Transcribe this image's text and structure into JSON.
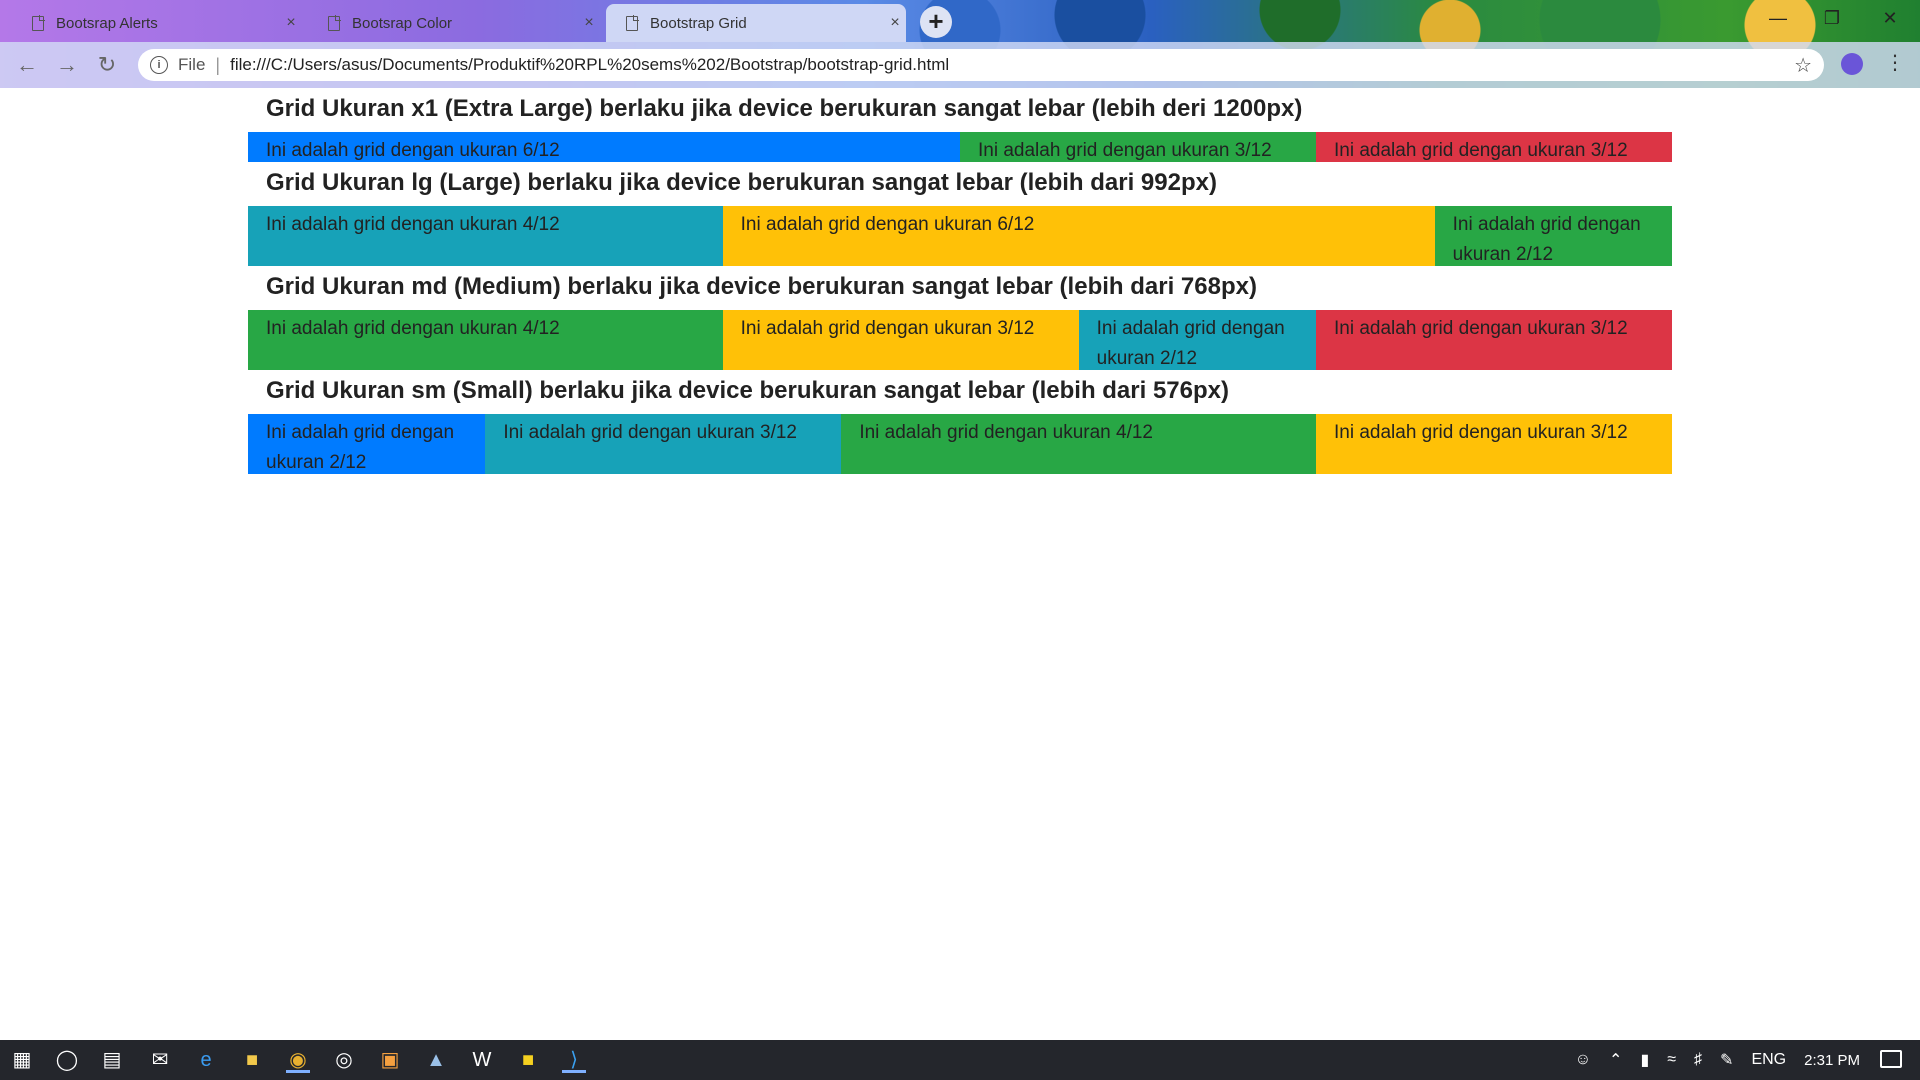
{
  "browser": {
    "tabs": [
      {
        "title": "Bootsrap Alerts",
        "close": "×"
      },
      {
        "title": "Bootsrap Color",
        "close": "×"
      },
      {
        "title": "Bootstrap Grid",
        "close": "×"
      }
    ],
    "new_tab": "+",
    "address": {
      "scheme_label": "File",
      "separator": "|",
      "url": "file:///C:/Users/asus/Documents/Produktif%20RPL%20sems%202/Bootstrap/bootstrap-grid.html"
    },
    "icons": {
      "back": "back-arrow-icon",
      "forward": "forward-arrow-icon",
      "reload": "reload-icon",
      "info": "info-icon",
      "bookmark": "star-icon",
      "profile": "profile-icon",
      "menu": "menu-icon"
    }
  },
  "page": {
    "sections": [
      {
        "title": "Grid Ukuran x1 (Extra Large) berlaku jika device berukuran sangat lebar (lebih deri 1200px)",
        "cols": [
          {
            "text": "Ini adalah grid dengan ukuran 6/12",
            "span": 6,
            "color": "#007bff"
          },
          {
            "text": "Ini adalah grid dengan ukuran 3/12",
            "span": 3,
            "color": "#28a745"
          },
          {
            "text": "Ini adalah grid dengan ukuran 3/12",
            "span": 3,
            "color": "#dc3545"
          }
        ]
      },
      {
        "title": "Grid Ukuran lg (Large) berlaku jika device berukuran sangat lebar (lebih dari 992px)",
        "cols": [
          {
            "text": "Ini adalah grid dengan ukuran 4/12",
            "span": 4,
            "color": "#17a2b8"
          },
          {
            "text": "Ini adalah grid dengan ukuran 6/12",
            "span": 6,
            "color": "#ffc107"
          },
          {
            "text": "Ini adalah grid dengan ukuran 2/12",
            "span": 2,
            "color": "#28a745"
          }
        ]
      },
      {
        "title": "Grid Ukuran md (Medium) berlaku jika device berukuran sangat lebar (lebih dari 768px)",
        "cols": [
          {
            "text": "Ini adalah grid dengan ukuran 4/12",
            "span": 4,
            "color": "#28a745"
          },
          {
            "text": "Ini adalah grid dengan ukuran 3/12",
            "span": 3,
            "color": "#ffc107"
          },
          {
            "text": "Ini adalah grid dengan ukuran 2/12",
            "span": 2,
            "color": "#17a2b8"
          },
          {
            "text": "Ini adalah grid dengan ukuran 3/12",
            "span": 3,
            "color": "#dc3545"
          }
        ]
      },
      {
        "title": "Grid Ukuran sm (Small) berlaku jika device berukuran sangat lebar (lebih dari 576px)",
        "cols": [
          {
            "text": "Ini adalah grid dengan ukuran 2/12",
            "span": 2,
            "color": "#007bff"
          },
          {
            "text": "Ini adalah grid dengan ukuran 3/12",
            "span": 3,
            "color": "#17a2b8"
          },
          {
            "text": "Ini adalah grid dengan ukuran 4/12",
            "span": 4,
            "color": "#28a745"
          },
          {
            "text": "Ini adalah grid dengan ukuran 3/12",
            "span": 3,
            "color": "#ffc107"
          }
        ]
      }
    ]
  },
  "taskbar": {
    "icons": [
      "windows-start-icon",
      "search-circle-icon",
      "task-view-icon",
      "mail-icon",
      "edge-icon",
      "file-explorer-icon",
      "chrome-icon",
      "groove-music-icon",
      "app-orange-icon",
      "app-blue-icon",
      "app-w-icon",
      "sticky-notes-icon",
      "vscode-icon"
    ],
    "tray": {
      "language": "ENG",
      "time": "2:31 PM"
    }
  }
}
